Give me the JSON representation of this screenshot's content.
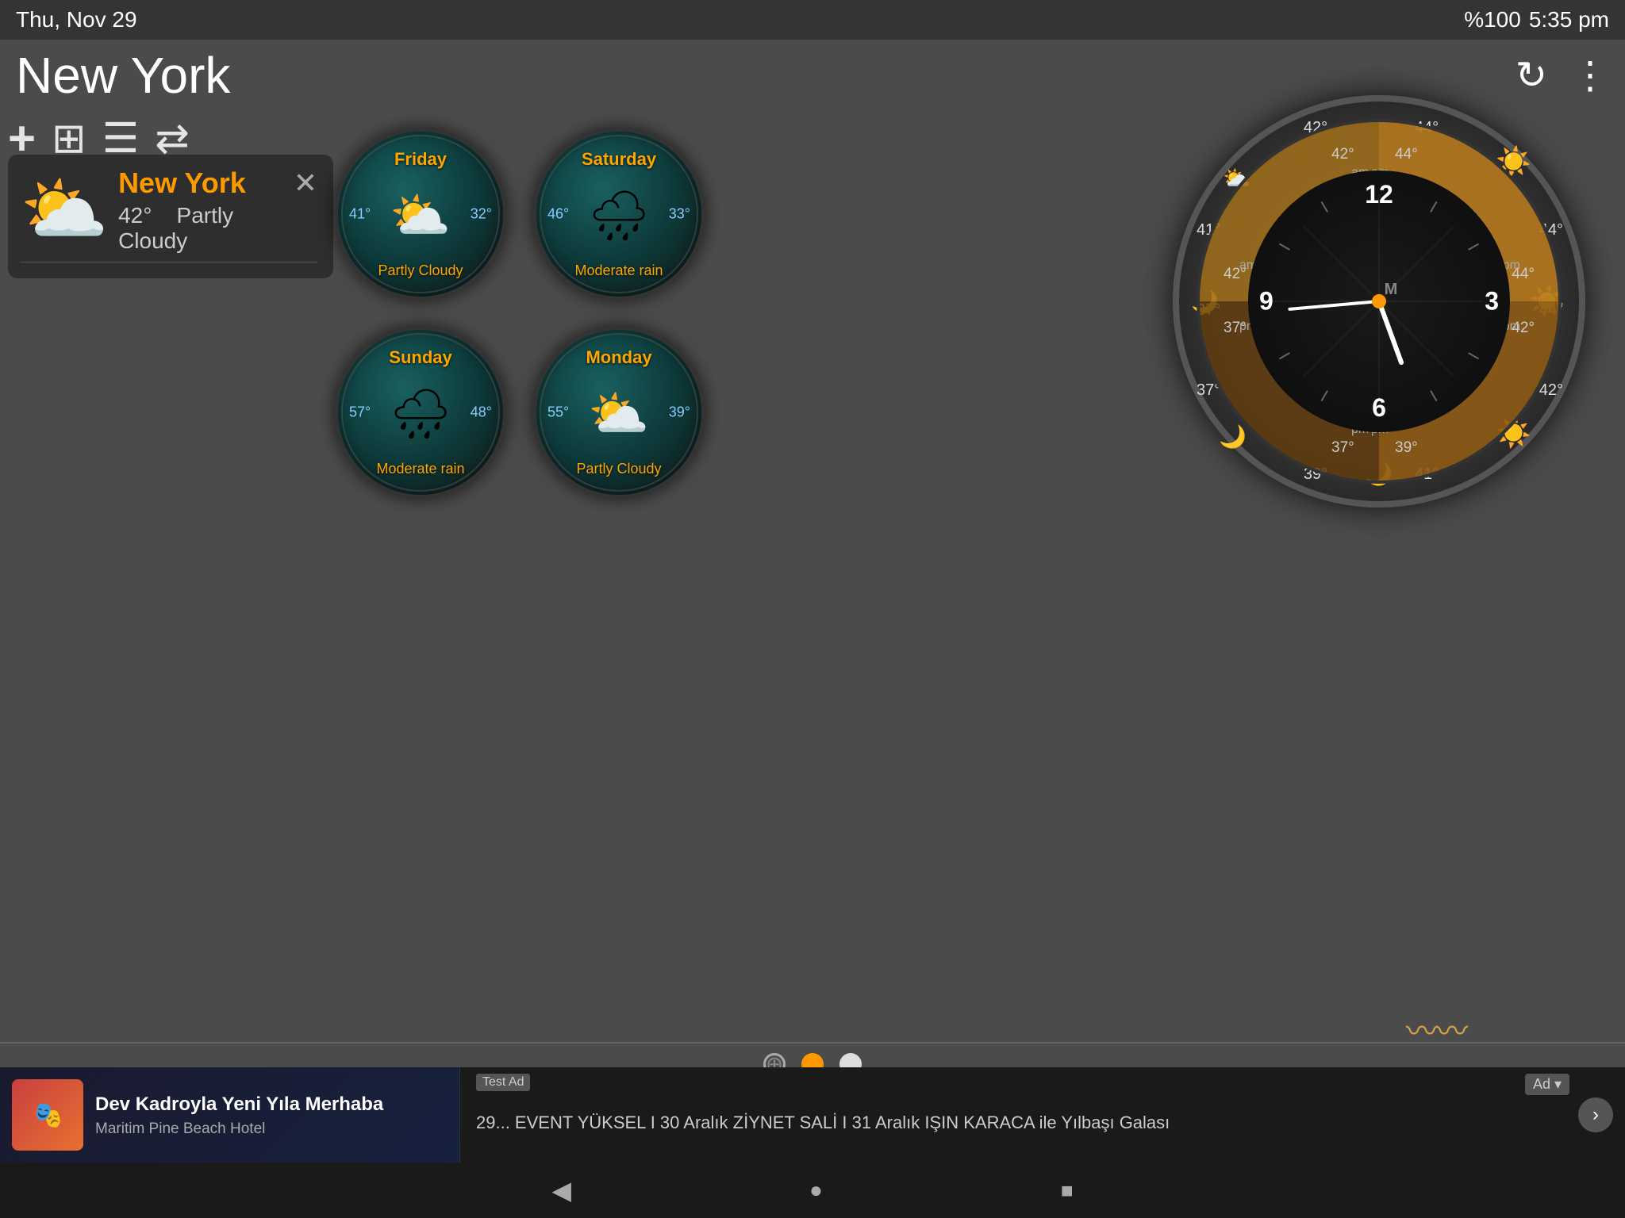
{
  "statusBar": {
    "date": "Thu, Nov 29",
    "battery": "%100",
    "time": "5:35 pm"
  },
  "header": {
    "city": "New York",
    "refreshLabel": "↻",
    "menuLabel": "⋮"
  },
  "toolbar": {
    "addLabel": "+",
    "widgetLabel": "⊞",
    "listLabel": "☰",
    "switchLabel": "⇄"
  },
  "currentWeather": {
    "city": "New York",
    "temp": "42°",
    "condition": "Partly Cloudy",
    "icon": "⛅"
  },
  "forecast": [
    {
      "day": "Friday",
      "icon": "⛅",
      "lowTemp": "41°",
      "highTemp": "32°",
      "condition": "Partly Cloudy"
    },
    {
      "day": "Saturday",
      "icon": "🌧",
      "lowTemp": "46°",
      "highTemp": "33°",
      "condition": "Moderate rain"
    },
    {
      "day": "Sunday",
      "icon": "🌧",
      "lowTemp": "57°",
      "highTemp": "48°",
      "condition": "Moderate rain"
    },
    {
      "day": "Monday",
      "icon": "⛅",
      "lowTemp": "55°",
      "highTemp": "39°",
      "condition": "Partly Cloudy"
    }
  ],
  "clock": {
    "numbers": [
      "12",
      "3",
      "6",
      "9"
    ],
    "temps_outer": [
      "44°",
      "44°",
      "42°",
      "44°",
      "42°",
      "42°",
      "39°",
      "41°",
      "42°",
      "37°",
      "37°",
      "41°"
    ],
    "temps_inner": [
      "42°",
      "44°",
      "42°",
      "37°",
      "37°",
      "39°"
    ]
  },
  "ads": {
    "left": {
      "title": "Dev Kadroyla Yeni Yıla Merhaba",
      "subtitle": "Maritim Pine Beach Hotel"
    },
    "right": {
      "badge": "Ad ▾",
      "text": "29... EVENT YÜKSEL I 30 Aralık ZİYNET SALİ I 31 Aralık IŞIN KARACA ile Yılbaşı Galası",
      "testBadge": "Test Ad"
    }
  },
  "nav": {
    "back": "◀",
    "home": "●",
    "recent": "■"
  }
}
